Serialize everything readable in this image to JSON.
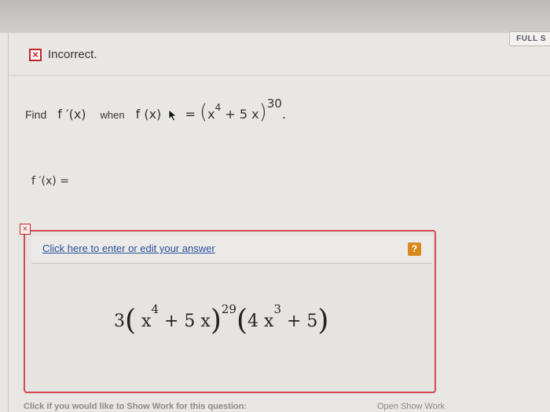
{
  "header": {
    "full_label": "FULL S"
  },
  "feedback": {
    "status_text": "Incorrect.",
    "status_icon": "close-icon",
    "status_color": "#c3272b"
  },
  "question": {
    "find_label": "Find",
    "derivative_notation": "f ′(x)",
    "when_label": "when",
    "function_lhs": "f (x)",
    "equals": "=",
    "inner_x": "x",
    "inner_exp": "4",
    "inner_rest": " + 5 x",
    "outer_exp": "30",
    "period": "."
  },
  "answer": {
    "label": "f ′(x) =",
    "edit_link": "Click here to enter or edit your answer",
    "help_label": "?",
    "expr": {
      "coef": "3",
      "x1": "x",
      "exp1": "4",
      "mid1": " + 5 x",
      "outer_exp": "29",
      "term2_coef": "4 x",
      "exp2": "3",
      "term2_rest": " + 5"
    }
  },
  "footer": {
    "left_text": "Click if you would like to Show Work for this question:",
    "right_text": "Open Show Work"
  }
}
